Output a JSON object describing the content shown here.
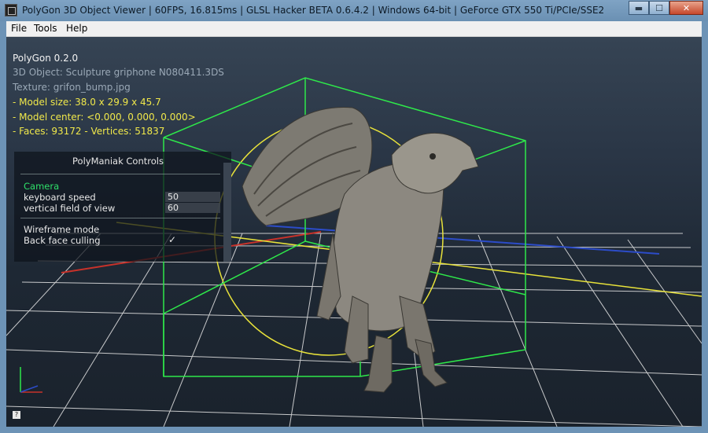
{
  "window": {
    "title": "PolyGon 3D Object Viewer | 60FPS, 16.815ms | GLSL Hacker BETA 0.6.4.2 | Windows 64-bit | GeForce GTX 550 Ti/PCIe/SSE2",
    "controls": {
      "minimize": "▬",
      "maximize": "☐",
      "close": "✕"
    }
  },
  "menu": {
    "items": [
      "File",
      "Tools",
      "Help"
    ]
  },
  "overlay": {
    "app_version": "PolyGon 0.2.0",
    "object": "3D Object: Sculpture griphone N080411.3DS",
    "texture": "Texture: grifon_bump.jpg",
    "model_size": "- Model size:  38.0 x 29.9 x 45.7",
    "model_center": "- Model center:  <0.000, 0.000, 0.000>",
    "faces_vertices": "- Faces: 93172 - Vertices: 51837"
  },
  "controls_panel": {
    "title": "PolyManiak Controls",
    "section_camera": "Camera",
    "keyboard_speed_label": "keyboard speed",
    "keyboard_speed_value": "50",
    "fov_label": "vertical field of view",
    "fov_value": "60",
    "wireframe_label": "Wireframe mode",
    "backface_label": "Back face culling",
    "backface_checked": "✓"
  },
  "help_badge": "?",
  "colors": {
    "grid": "#e6e6e6",
    "bounding_box": "#2ee84a",
    "bounding_sphere": "#e8e23a",
    "axis_x": "#c8322a",
    "axis_z": "#2c4cc8",
    "overlay_highlight": "#f0e84a"
  },
  "icons": {
    "app": "app-window-icon",
    "model": "griffin-sculpture"
  }
}
